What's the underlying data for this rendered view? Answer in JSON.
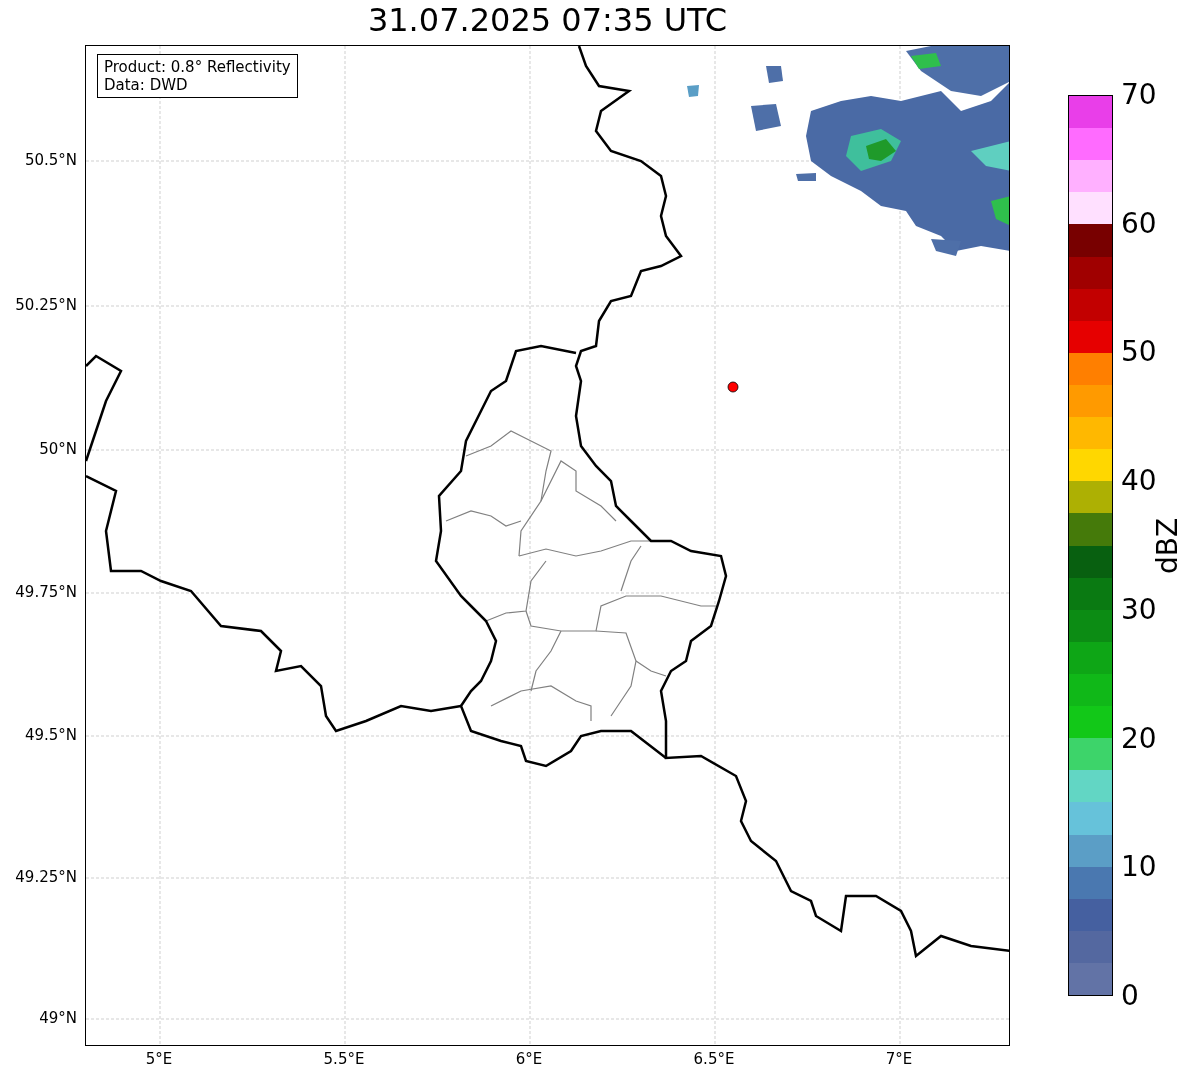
{
  "title": "31.07.2025 07:35 UTC",
  "info_box": [
    "Product: 0.8° Reflectivity",
    "Data: DWD"
  ],
  "lat_ticks": [
    "50.5°N",
    "50.25°N",
    "50°N",
    "49.75°N",
    "49.5°N",
    "49.25°N",
    "49°N"
  ],
  "lon_ticks": [
    "5°E",
    "5.5°E",
    "6°E",
    "6.5°E",
    "7°E"
  ],
  "colorbar": {
    "label": "dBZ",
    "ticks": [
      "70",
      "60",
      "50",
      "40",
      "30",
      "20",
      "10",
      "0"
    ],
    "segments": [
      {
        "color": "#e93ee9"
      },
      {
        "color": "#ff6bff"
      },
      {
        "color": "#ffb0ff"
      },
      {
        "color": "#ffe0ff"
      },
      {
        "color": "#780000"
      },
      {
        "color": "#a00000"
      },
      {
        "color": "#c20000"
      },
      {
        "color": "#e60000"
      },
      {
        "color": "#ff7f00"
      },
      {
        "color": "#ff9a00"
      },
      {
        "color": "#ffb800"
      },
      {
        "color": "#ffd700"
      },
      {
        "color": "#adb003"
      },
      {
        "color": "#457a0a"
      },
      {
        "color": "#086010"
      },
      {
        "color": "#0a7a12"
      },
      {
        "color": "#0c8c14"
      },
      {
        "color": "#0ea616"
      },
      {
        "color": "#10b818"
      },
      {
        "color": "#12c818"
      },
      {
        "color": "#3dd46a"
      },
      {
        "color": "#62d6c4"
      },
      {
        "color": "#66c2da"
      },
      {
        "color": "#5b9ec6"
      },
      {
        "color": "#4a78b0"
      },
      {
        "color": "#4560a0"
      },
      {
        "color": "#5468a0"
      },
      {
        "color": "#6273a6"
      }
    ]
  }
}
